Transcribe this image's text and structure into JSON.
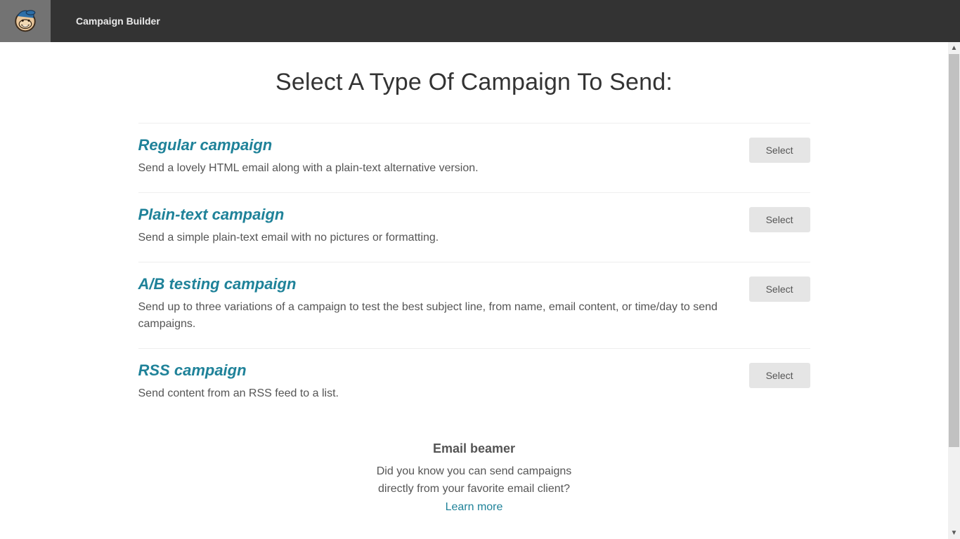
{
  "header": {
    "breadcrumb": "Campaign Builder"
  },
  "page": {
    "title": "Select A Type Of Campaign To Send:"
  },
  "campaignTypes": [
    {
      "title": "Regular campaign",
      "description": "Send a lovely HTML email along with a plain-text alternative version.",
      "button": "Select"
    },
    {
      "title": "Plain-text campaign",
      "description": "Send a simple plain-text email with no pictures or formatting.",
      "button": "Select"
    },
    {
      "title": "A/B testing campaign",
      "description": "Send up to three variations of a campaign to test the best subject line, from name, email content, or time/day to send campaigns.",
      "button": "Select"
    },
    {
      "title": "RSS campaign",
      "description": "Send content from an RSS feed to a list.",
      "button": "Select"
    }
  ],
  "beamer": {
    "title": "Email beamer",
    "line1": "Did you know you can send campaigns",
    "line2": "directly from your favorite email client?",
    "link": "Learn more"
  }
}
